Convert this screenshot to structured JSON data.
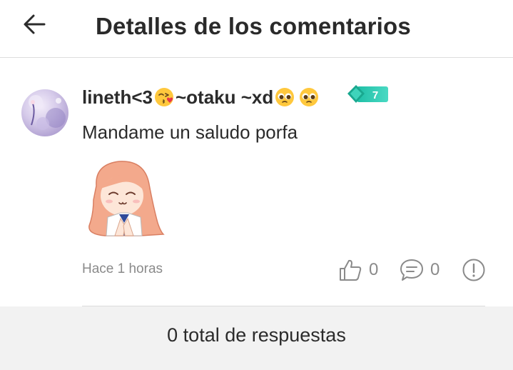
{
  "header": {
    "title": "Detalles de los comentarios",
    "back_icon": "arrow-left-icon"
  },
  "comment": {
    "username_prefix": "lineth<3",
    "username_middle": "~otaku ~xd",
    "username_emojis": [
      "kissing-face-emoji",
      "pleading-face-emoji",
      "pleading-face-emoji"
    ],
    "level": "7",
    "level_badge_colors": [
      "#1fbfa6",
      "#49d9c3"
    ],
    "text": "Mandame un saludo porfa",
    "sticker": "anime-girl-praying-sticker",
    "timestamp": "Hace 1 horas",
    "likes": "0",
    "replies": "0"
  },
  "footer": {
    "total_label": "0 total de respuestas"
  },
  "colors": {
    "text_primary": "#2b2b2b",
    "text_secondary": "#8a8a8a",
    "footer_bg": "#f2f2f2",
    "accent_badge": "#2ccfb4"
  }
}
